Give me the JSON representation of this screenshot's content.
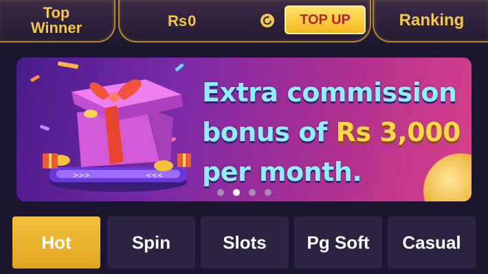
{
  "header": {
    "top_winner_line1": "Top",
    "top_winner_line2": "Winner",
    "balance_currency": "Rs",
    "balance_value": "0",
    "topup_label": "TOP UP",
    "ranking_label": "Ranking"
  },
  "banner": {
    "line1": "Extra commission",
    "line2_prefix": "bonus of",
    "line2_amount": "Rs 3,000",
    "line3": "per month.",
    "slide_count": 4,
    "active_slide": 2
  },
  "tabs": [
    {
      "label": "Hot",
      "active": true
    },
    {
      "label": "Spin",
      "active": false
    },
    {
      "label": "Slots",
      "active": false
    },
    {
      "label": "Pg Soft",
      "active": false
    },
    {
      "label": "Casual",
      "active": false
    }
  ],
  "colors": {
    "background": "#1b1530",
    "accent_gold": "#f5c84a",
    "topup_text": "#b8202a",
    "headline_cyan": "#8ef0f7",
    "amount_yellow": "#ffd84a",
    "tab_inactive": "#2b2341",
    "tab_active": "#e9b22c"
  },
  "icons": {
    "refresh": "refresh-icon",
    "gift": "gift-box-illustration"
  }
}
